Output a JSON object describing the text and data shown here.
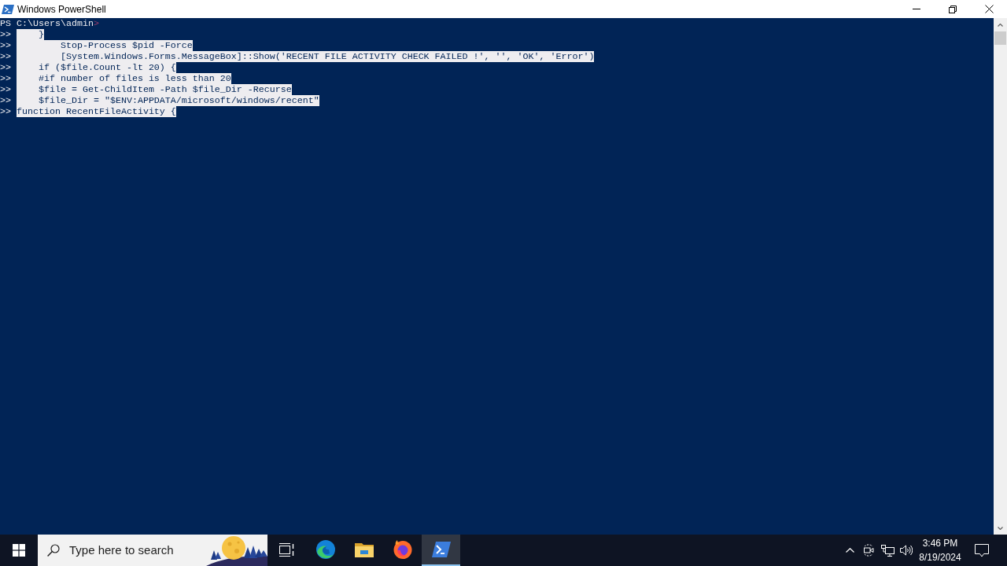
{
  "window": {
    "title": "Windows PowerShell"
  },
  "console": {
    "prompt": {
      "path": "PS C:\\Users\\admin",
      "symbol": ">"
    },
    "lines": [
      {
        "prompt": ">>",
        "code": "    }",
        "selected": true
      },
      {
        "prompt": ">>",
        "code": "        Stop-Process $pid -Force",
        "selected": true
      },
      {
        "prompt": ">>",
        "code": "        [System.Windows.Forms.MessageBox]::Show('RECENT FILE ACTIVITY CHECK FAILED !', '', 'OK', 'Error')",
        "selected": true
      },
      {
        "prompt": ">>",
        "code": "    if ($file.Count -lt 20) {",
        "selected": true
      },
      {
        "prompt": ">>",
        "code": "    #if number of files is less than 20",
        "selected": true
      },
      {
        "prompt": ">>",
        "code": "    $file = Get-ChildItem -Path $file_Dir -Recurse",
        "selected": true
      },
      {
        "prompt": ">>",
        "code": "    $file_Dir = \"$ENV:APPDATA/microsoft/windows/recent\"",
        "selected": true
      },
      {
        "prompt": ">>",
        "code": "function RecentFileActivity {",
        "selected": true
      }
    ]
  },
  "taskbar": {
    "search": {
      "placeholder": "Type here to search"
    },
    "apps": [
      {
        "kind": "task-view",
        "selected": false
      },
      {
        "kind": "edge",
        "selected": false
      },
      {
        "kind": "file-explorer",
        "selected": false
      },
      {
        "kind": "firefox",
        "selected": false
      },
      {
        "kind": "powershell",
        "selected": true
      }
    ],
    "clock": {
      "time": "3:46 PM",
      "date": "8/19/2024"
    }
  }
}
